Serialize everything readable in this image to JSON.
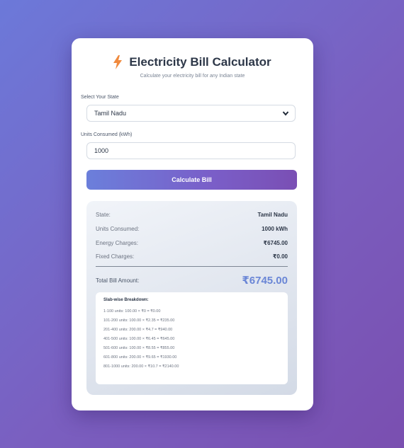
{
  "header": {
    "title": "Electricity Bill Calculator",
    "subtitle": "Calculate your electricity bill for any Indian state"
  },
  "form": {
    "state_label": "Select Your State",
    "state_value": "Tamil Nadu",
    "units_label": "Units Consumed (kWh)",
    "units_value": "1000",
    "calculate_label": "Calculate Bill"
  },
  "result": {
    "rows": [
      {
        "label": "State:",
        "value": "Tamil Nadu"
      },
      {
        "label": "Units Consumed:",
        "value": "1000 kWh"
      },
      {
        "label": "Energy Charges:",
        "value": "₹6745.00"
      },
      {
        "label": "Fixed Charges:",
        "value": "₹0.00"
      }
    ],
    "total_label": "Total Bill Amount:",
    "total_value": "₹6745.00",
    "breakdown_title": "Slab-wise Breakdown:",
    "breakdown": [
      "1-100 units: 100.00 × ₹0 = ₹0.00",
      "101-200 units: 100.00 × ₹2.35 = ₹235.00",
      "201-400 units: 200.00 × ₹4.7 = ₹940.00",
      "401-500 units: 100.00 × ₹6.45 = ₹645.00",
      "501-600 units: 100.00 × ₹8.55 = ₹855.00",
      "601-800 units: 200.00 × ₹9.65 = ₹1930.00",
      "801-1000 units: 200.00 × ₹10.7 = ₹2140.00"
    ]
  },
  "icons": {
    "title_icon": "lightning-bolt-icon",
    "select_icon": "chevron-down-icon"
  },
  "colors": {
    "accent": "#6b7fdb",
    "bolt": "#f08a3e",
    "total": "#6a86d6"
  }
}
